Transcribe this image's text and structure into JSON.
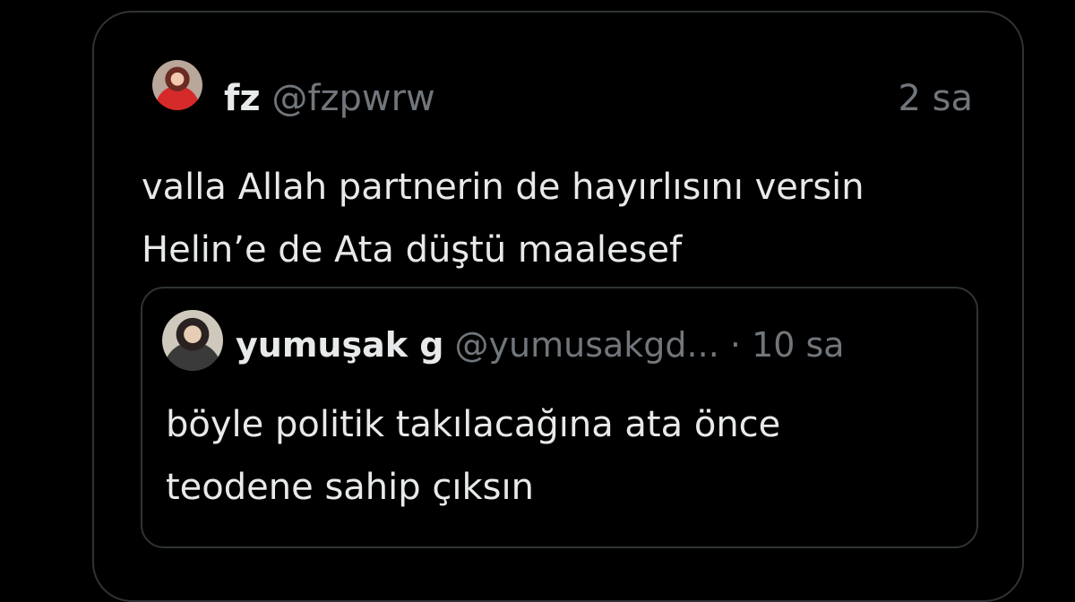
{
  "tweet": {
    "author": {
      "display_name": "fz",
      "handle": "@fzpwrw",
      "avatar_icon": "profile-photo-icon"
    },
    "timestamp": "2 sa",
    "text_lines": [
      "valla Allah partnerin de hayırlısını versin",
      "Helin’e de Ata düştü maalesef"
    ],
    "quoted_tweet": {
      "author": {
        "display_name": "yumuşak g",
        "handle": "@yumusakgd...",
        "avatar_icon": "profile-photo-icon"
      },
      "separator": "·",
      "timestamp": "10 sa",
      "text_lines": [
        "böyle politik takılacağına ata önce",
        "teodene sahip çıksın"
      ]
    }
  },
  "colors": {
    "background": "#000000",
    "border": "#2f3336",
    "primary_text": "#e7e9ea",
    "secondary_text": "#71767b"
  }
}
